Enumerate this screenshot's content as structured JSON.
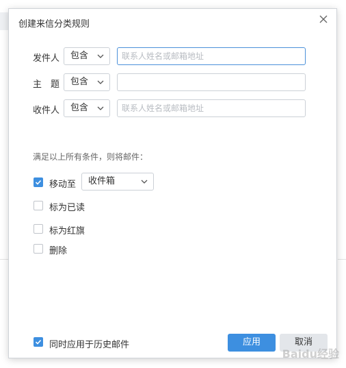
{
  "dialog": {
    "title": "创建来信分类规则",
    "close_icon": "close-icon"
  },
  "conditions": [
    {
      "label": "发件人",
      "operator": "包含",
      "value": "",
      "placeholder": "联系人姓名或邮箱地址"
    },
    {
      "label": "主　题",
      "operator": "包含",
      "value": "",
      "placeholder": ""
    },
    {
      "label": "收件人",
      "operator": "包含",
      "value": "",
      "placeholder": "联系人姓名或邮箱地址"
    }
  ],
  "actions_hint": "满足以上所有条件，则将邮件：",
  "actions": [
    {
      "label": "移动至",
      "checked": true,
      "target": "收件箱"
    },
    {
      "label": "标为已读",
      "checked": false
    },
    {
      "label": "标为红旗",
      "checked": false
    },
    {
      "label": "删除",
      "checked": false
    }
  ],
  "footer": {
    "apply_history_label": "同时应用于历史邮件",
    "apply_history_checked": true,
    "apply_button": "应用",
    "cancel_button": "取消"
  },
  "watermark": "Baidu经验",
  "colors": {
    "accent": "#3d8fe0",
    "border": "#cbd0d6",
    "focus_border": "#4a90d9"
  }
}
